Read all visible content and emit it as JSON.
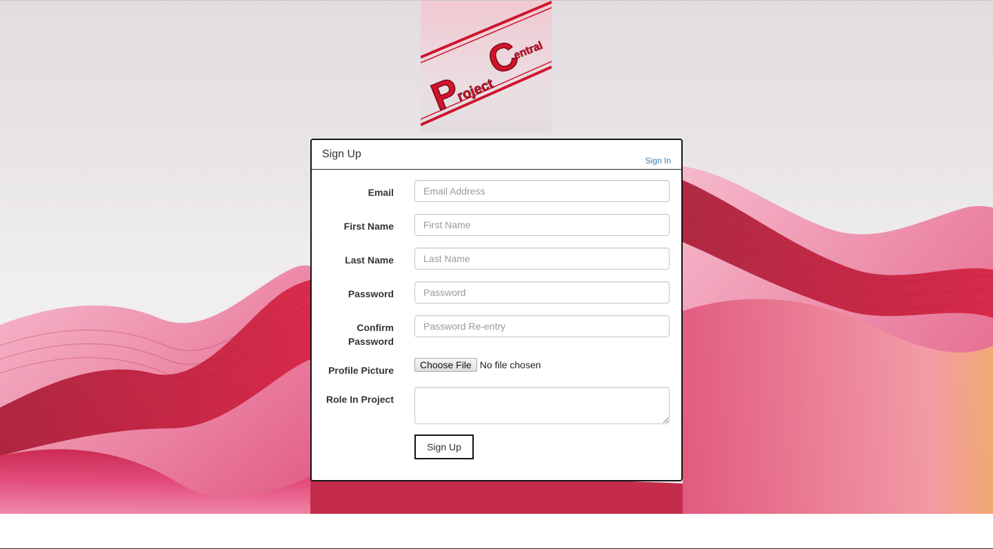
{
  "logo": {
    "alt": "Project Central",
    "word1": "Project",
    "word2": "Central",
    "color": "#d0142c"
  },
  "form": {
    "title": "Sign Up",
    "signin_link": "Sign In",
    "fields": {
      "email": {
        "label": "Email",
        "placeholder": "Email Address",
        "value": ""
      },
      "first_name": {
        "label": "First Name",
        "placeholder": "First Name",
        "value": ""
      },
      "last_name": {
        "label": "Last Name",
        "placeholder": "Last Name",
        "value": ""
      },
      "password": {
        "label": "Password",
        "placeholder": "Password",
        "value": ""
      },
      "confirm_password": {
        "label_line1": "Confirm",
        "label_line2": "Password",
        "placeholder": "Password Re-entry",
        "value": ""
      },
      "profile_picture": {
        "label": "Profile Picture",
        "button": "Choose File",
        "status": "No file chosen"
      },
      "role": {
        "label": "Role In Project",
        "value": ""
      }
    },
    "submit_label": "Sign Up"
  },
  "colors": {
    "accent_link": "#337ab7",
    "brand_red": "#d0142c",
    "background_silk": "#e03a68"
  }
}
